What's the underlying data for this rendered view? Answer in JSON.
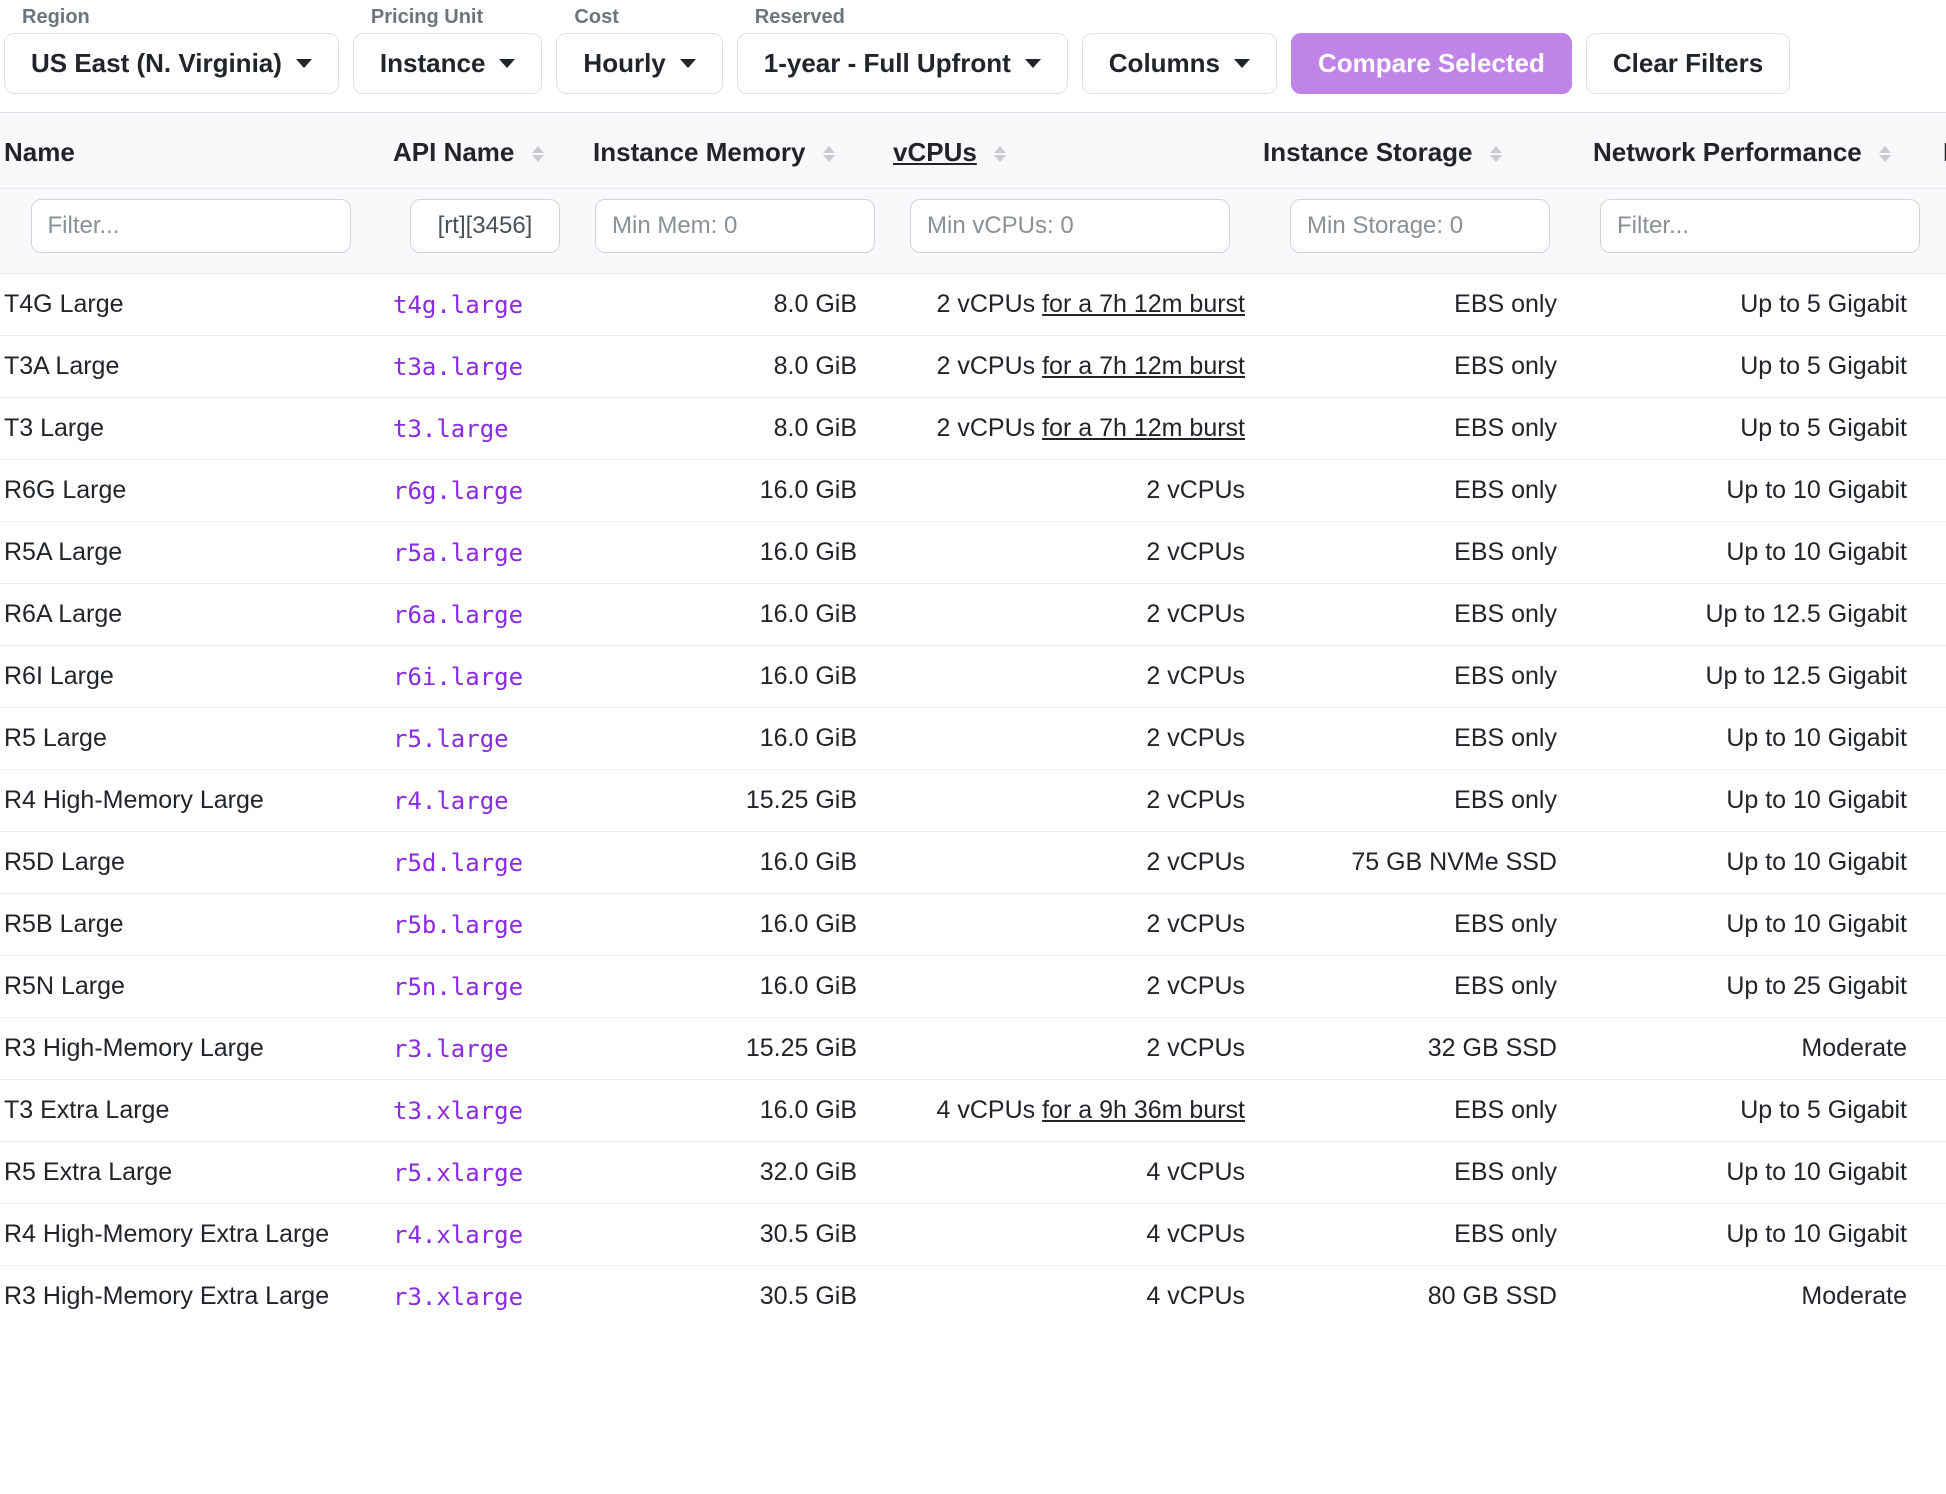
{
  "toolbar": {
    "region": {
      "label": "Region",
      "value": "US East (N. Virginia)"
    },
    "unit": {
      "label": "Pricing Unit",
      "value": "Instance"
    },
    "cost": {
      "label": "Cost",
      "value": "Hourly"
    },
    "reserved": {
      "label": "Reserved",
      "value": "1-year - Full Upfront"
    },
    "columns_btn": "Columns",
    "compare_btn": "Compare Selected",
    "clear_btn": "Clear Filters"
  },
  "columns": [
    {
      "key": "name",
      "label": "Name",
      "sortable": false,
      "filter_ph": "Filter..."
    },
    {
      "key": "api",
      "label": "API Name",
      "sortable": true,
      "filter_val": "[rt][3456]"
    },
    {
      "key": "mem",
      "label": "Instance Memory",
      "sortable": true,
      "filter_ph": "Min Mem: 0"
    },
    {
      "key": "vcpu",
      "label": "vCPUs",
      "sortable": true,
      "sorted": true,
      "filter_ph": "Min vCPUs: 0"
    },
    {
      "key": "storage",
      "label": "Instance Storage",
      "sortable": true,
      "filter_ph": "Min Storage: 0"
    },
    {
      "key": "net",
      "label": "Network Performance",
      "sortable": true,
      "filter_ph": "Filter..."
    },
    {
      "key": "last",
      "label": "L",
      "sortable": false
    }
  ],
  "rows": [
    {
      "name": "T4G Large",
      "api": "t4g.large",
      "mem": "8.0 GiB",
      "vcpu_n": "2 vCPUs",
      "burst": "for a 7h 12m burst",
      "storage": "EBS only",
      "net": "Up to 5 Gigabit"
    },
    {
      "name": "T3A Large",
      "api": "t3a.large",
      "mem": "8.0 GiB",
      "vcpu_n": "2 vCPUs",
      "burst": "for a 7h 12m burst",
      "storage": "EBS only",
      "net": "Up to 5 Gigabit"
    },
    {
      "name": "T3 Large",
      "api": "t3.large",
      "mem": "8.0 GiB",
      "vcpu_n": "2 vCPUs",
      "burst": "for a 7h 12m burst",
      "storage": "EBS only",
      "net": "Up to 5 Gigabit"
    },
    {
      "name": "R6G Large",
      "api": "r6g.large",
      "mem": "16.0 GiB",
      "vcpu_n": "2 vCPUs",
      "burst": "",
      "storage": "EBS only",
      "net": "Up to 10 Gigabit"
    },
    {
      "name": "R5A Large",
      "api": "r5a.large",
      "mem": "16.0 GiB",
      "vcpu_n": "2 vCPUs",
      "burst": "",
      "storage": "EBS only",
      "net": "Up to 10 Gigabit"
    },
    {
      "name": "R6A Large",
      "api": "r6a.large",
      "mem": "16.0 GiB",
      "vcpu_n": "2 vCPUs",
      "burst": "",
      "storage": "EBS only",
      "net": "Up to 12.5 Gigabit"
    },
    {
      "name": "R6I Large",
      "api": "r6i.large",
      "mem": "16.0 GiB",
      "vcpu_n": "2 vCPUs",
      "burst": "",
      "storage": "EBS only",
      "net": "Up to 12.5 Gigabit"
    },
    {
      "name": "R5 Large",
      "api": "r5.large",
      "mem": "16.0 GiB",
      "vcpu_n": "2 vCPUs",
      "burst": "",
      "storage": "EBS only",
      "net": "Up to 10 Gigabit"
    },
    {
      "name": "R4 High-Memory Large",
      "api": "r4.large",
      "mem": "15.25 GiB",
      "vcpu_n": "2 vCPUs",
      "burst": "",
      "storage": "EBS only",
      "net": "Up to 10 Gigabit"
    },
    {
      "name": "R5D Large",
      "api": "r5d.large",
      "mem": "16.0 GiB",
      "vcpu_n": "2 vCPUs",
      "burst": "",
      "storage": "75 GB NVMe SSD",
      "net": "Up to 10 Gigabit"
    },
    {
      "name": "R5B Large",
      "api": "r5b.large",
      "mem": "16.0 GiB",
      "vcpu_n": "2 vCPUs",
      "burst": "",
      "storage": "EBS only",
      "net": "Up to 10 Gigabit"
    },
    {
      "name": "R5N Large",
      "api": "r5n.large",
      "mem": "16.0 GiB",
      "vcpu_n": "2 vCPUs",
      "burst": "",
      "storage": "EBS only",
      "net": "Up to 25 Gigabit"
    },
    {
      "name": "R3 High-Memory Large",
      "api": "r3.large",
      "mem": "15.25 GiB",
      "vcpu_n": "2 vCPUs",
      "burst": "",
      "storage": "32 GB SSD",
      "net": "Moderate"
    },
    {
      "name": "T3 Extra Large",
      "api": "t3.xlarge",
      "mem": "16.0 GiB",
      "vcpu_n": "4 vCPUs",
      "burst": "for a 9h 36m burst",
      "storage": "EBS only",
      "net": "Up to 5 Gigabit"
    },
    {
      "name": "R5 Extra Large",
      "api": "r5.xlarge",
      "mem": "32.0 GiB",
      "vcpu_n": "4 vCPUs",
      "burst": "",
      "storage": "EBS only",
      "net": "Up to 10 Gigabit"
    },
    {
      "name": "R4 High-Memory Extra Large",
      "api": "r4.xlarge",
      "mem": "30.5 GiB",
      "vcpu_n": "4 vCPUs",
      "burst": "",
      "storage": "EBS only",
      "net": "Up to 10 Gigabit"
    },
    {
      "name": "R3 High-Memory Extra Large",
      "api": "r3.xlarge",
      "mem": "30.5 GiB",
      "vcpu_n": "4 vCPUs",
      "burst": "",
      "storage": "80 GB SSD",
      "net": "Moderate"
    }
  ]
}
